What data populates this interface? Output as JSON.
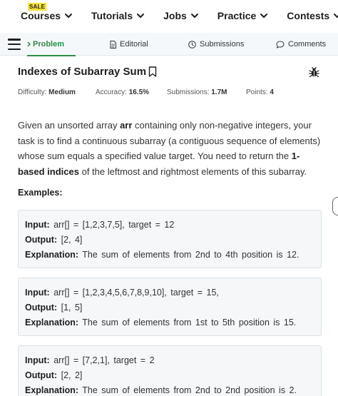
{
  "topnav": {
    "sale_badge": "SALE",
    "items": [
      {
        "label": "Courses"
      },
      {
        "label": "Tutorials"
      },
      {
        "label": "Jobs"
      },
      {
        "label": "Practice"
      },
      {
        "label": "Contests"
      }
    ]
  },
  "tabs": {
    "problem": "Problem",
    "editorial": "Editorial",
    "submissions": "Submissions",
    "comments": "Comments"
  },
  "problem": {
    "title": "Indexes of Subarray Sum",
    "difficulty_label": "Difficulty:",
    "difficulty": "Medium",
    "accuracy_label": "Accuracy:",
    "accuracy": "16.5%",
    "submissions_label": "Submissions:",
    "submissions": "1.7M",
    "points_label": "Points:",
    "points": "4",
    "desc_1": "Given an unsorted array ",
    "desc_arr": "arr",
    "desc_2": " containing only non-negative integers, your task is to find a continuous subarray (a contiguous sequence of elements) whose sum equals a specified value target. You need to return the ",
    "desc_bold": "1-based indices",
    "desc_3": " of the leftmost and rightmost elements of this subarray."
  },
  "examples_heading": "Examples:",
  "examples": [
    {
      "input_label": "Input:",
      "input": "arr[] = [1,2,3,7,5], target = 12",
      "output_label": "Output:",
      "output": "[2, 4]",
      "explanation_label": "Explanation:",
      "explanation": "The sum of elements from 2nd to 4th position is 12."
    },
    {
      "input_label": "Input:",
      "input": "arr[] = [1,2,3,4,5,6,7,8,9,10], target = 15,",
      "output_label": "Output:",
      "output": "[1, 5]",
      "explanation_label": "Explanation:",
      "explanation": "The sum of elements from 1st to 5th position is 15."
    },
    {
      "input_label": "Input:",
      "input": "arr[] = [7,2,1], target = 2",
      "output_label": "Output:",
      "output": "[2, 2]",
      "explanation_label": "Explanation:",
      "explanation": "The sum of elements from 2nd to 2nd position is 2."
    }
  ],
  "colors": {
    "accent": "#2f8d46",
    "sale": "#f7e23a"
  },
  "icons": [
    "chevron-down-icon",
    "hamburger-icon",
    "document-icon",
    "clock-icon",
    "comment-icon",
    "bookmark-icon",
    "bug-icon"
  ]
}
